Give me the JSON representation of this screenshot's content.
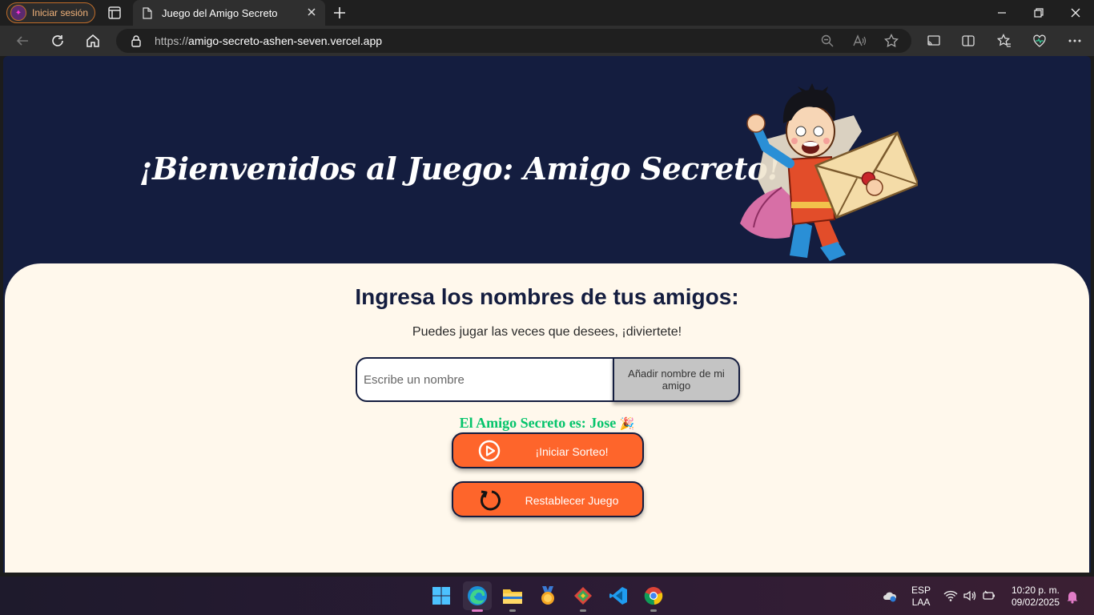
{
  "browser": {
    "profile_label": "Iniciar sesión",
    "tab_title": "Juego del Amigo Secreto",
    "url_scheme": "https://",
    "url_host": "amigo-secreto-ashen-seven.vercel.app"
  },
  "page": {
    "hero_title": "¡Bienvenidos al Juego: Amigo Secreto!",
    "section_title": "Ingresa los nombres de tus amigos:",
    "subtitle": "Puedes jugar las veces que desees, ¡diviertete!",
    "name_input_placeholder": "Escribe un nombre",
    "name_input_value": "",
    "add_button_label": "Añadir nombre de mi amigo",
    "result_text": "El Amigo Secreto es: Jose",
    "result_emoji": "🎉",
    "draw_button_label": "¡Iniciar Sorteo!",
    "reset_button_label": "Restablecer Juego"
  },
  "colors": {
    "header_bg": "#141d3f",
    "card_bg": "#fff8ec",
    "accent_orange": "#fe652b",
    "result_green": "#05c46b"
  },
  "taskbar": {
    "apps": [
      "windows-start",
      "edge",
      "file-explorer",
      "medal-app",
      "git-app",
      "vscode",
      "chrome"
    ],
    "lang_line1": "ESP",
    "lang_line2": "LAA",
    "time": "10:20 p. m.",
    "date": "09/02/2025"
  }
}
